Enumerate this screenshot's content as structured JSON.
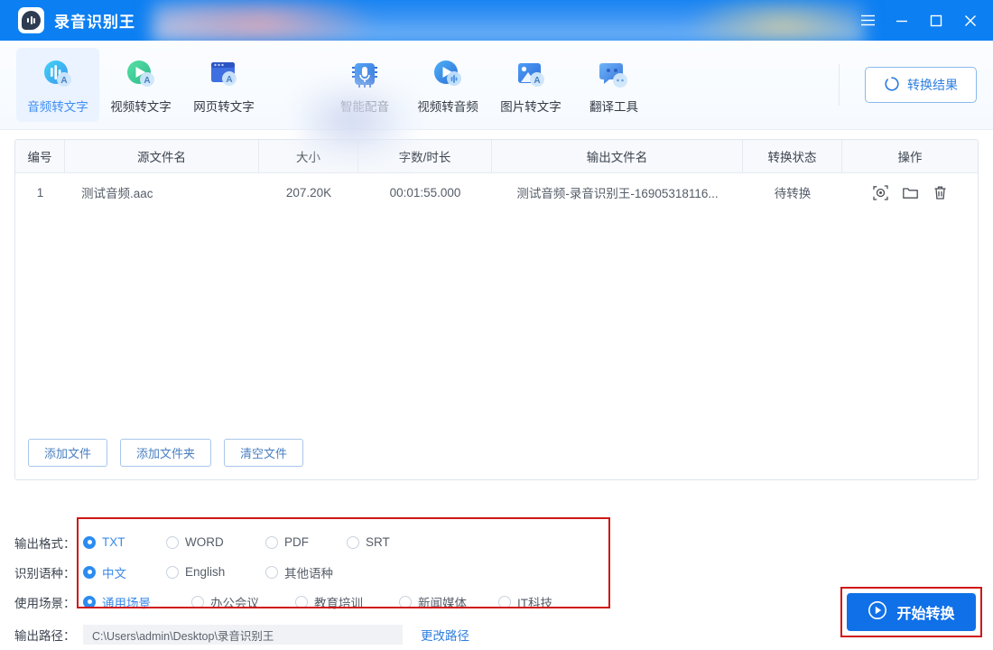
{
  "window": {
    "title": "录音识别王",
    "logo_icon": "speech-bubble-waveform-icon",
    "controls": [
      {
        "name": "menu",
        "icon": "hamburger-menu-icon"
      },
      {
        "name": "minimize",
        "icon": "minimize-icon"
      },
      {
        "name": "maximize",
        "icon": "maximize-icon"
      },
      {
        "name": "close",
        "icon": "close-icon"
      }
    ],
    "accent_color": "#0c7ff2"
  },
  "nav": {
    "items": [
      {
        "label": "音频转文字",
        "icon": "audio-to-text-icon",
        "active": true
      },
      {
        "label": "视频转文字",
        "icon": "video-to-text-icon",
        "active": false
      },
      {
        "label": "网页转文字",
        "icon": "webpage-to-text-icon",
        "active": false
      },
      {
        "label": "智能配音",
        "icon": "smart-dubbing-icon",
        "active": false
      },
      {
        "label": "视频转音频",
        "icon": "video-to-audio-icon",
        "active": false
      },
      {
        "label": "图片转文字",
        "icon": "image-to-text-icon",
        "active": false
      },
      {
        "label": "翻译工具",
        "icon": "translate-tool-icon",
        "active": false
      }
    ],
    "result_button": {
      "label": "转换结果",
      "icon": "refresh-circle-icon"
    }
  },
  "table": {
    "headers": [
      "编号",
      "源文件名",
      "大小",
      "字数/时长",
      "输出文件名",
      "转换状态",
      "操作"
    ],
    "rows": [
      {
        "index": "1",
        "source_name": "测试音频.aac",
        "size": "207.20K",
        "duration": "00:01:55.000",
        "output_name": "测试音频-录音识别王-16905318116...",
        "status": "待转换",
        "actions": [
          "preview-icon",
          "folder-icon",
          "delete-icon"
        ]
      }
    ]
  },
  "file_buttons": [
    {
      "label": "添加文件"
    },
    {
      "label": "添加文件夹"
    },
    {
      "label": "清空文件"
    }
  ],
  "settings": {
    "format": {
      "label": "输出格式：",
      "options": [
        {
          "label": "TXT",
          "selected": true
        },
        {
          "label": "WORD",
          "selected": false
        },
        {
          "label": "PDF",
          "selected": false
        },
        {
          "label": "SRT",
          "selected": false
        }
      ]
    },
    "language": {
      "label": "识别语种：",
      "options": [
        {
          "label": "中文",
          "selected": true
        },
        {
          "label": "English",
          "selected": false
        },
        {
          "label": "其他语种",
          "selected": false
        }
      ]
    },
    "scene": {
      "label": "使用场景：",
      "options": [
        {
          "label": "通用场景",
          "selected": true
        },
        {
          "label": "办公会议",
          "selected": false
        },
        {
          "label": "教育培训",
          "selected": false
        },
        {
          "label": "新闻媒体",
          "selected": false
        },
        {
          "label": "IT科技",
          "selected": false
        }
      ]
    },
    "path": {
      "label": "输出路径：",
      "value": "C:\\Users\\admin\\Desktop\\录音识别王",
      "change_link": "更改路径"
    },
    "highlight_color": "#cf1717"
  },
  "start_button": {
    "label": "开始转换",
    "icon": "play-circle-icon"
  }
}
